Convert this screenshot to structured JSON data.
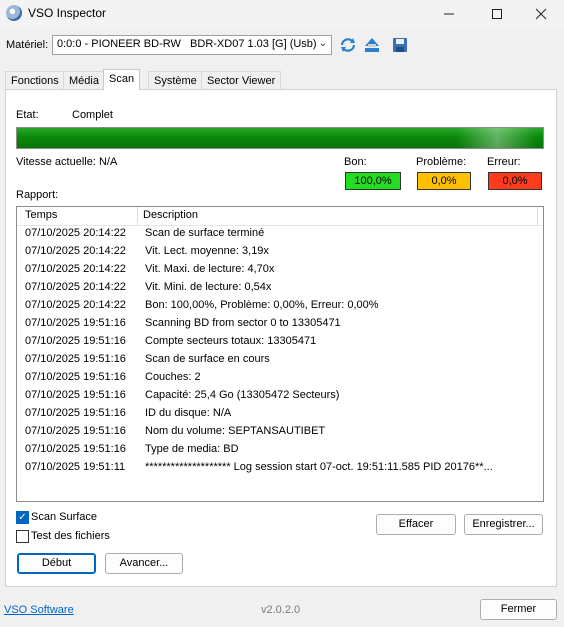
{
  "window": {
    "title": "VSO Inspector",
    "icon": "vso-app-icon"
  },
  "device": {
    "label": "Matériel:",
    "selected": "0:0:0 - PIONEER BD-RW   BDR-XD07 1.03 [G] (Usb)"
  },
  "tabs": [
    {
      "label": "Fonctions"
    },
    {
      "label": "Média"
    },
    {
      "label": "Scan"
    },
    {
      "label": "Système"
    },
    {
      "label": "Sector Viewer"
    }
  ],
  "active_tab": "Scan",
  "status": {
    "state_label": "Etat:",
    "state_value": "Complet",
    "progress_fraction": 1.0,
    "speed_label": "Vitesse actuelle: N/A",
    "report_label": "Rapport:",
    "good": {
      "label": "Bon:",
      "value": "100,0%",
      "color": "#22dd22"
    },
    "problem": {
      "label": "Problème:",
      "value": "0,0%",
      "color": "#ffc000"
    },
    "error": {
      "label": "Erreur:",
      "value": "0,0%",
      "color": "#ff3b1f"
    }
  },
  "report": {
    "columns": [
      "Temps",
      "Description"
    ],
    "rows": [
      {
        "time": "07/10/2025 20:14:22",
        "desc": "Scan de surface terminé"
      },
      {
        "time": "07/10/2025 20:14:22",
        "desc": "Vit. Lect. moyenne: 3,19x"
      },
      {
        "time": "07/10/2025 20:14:22",
        "desc": "Vit. Maxi. de lecture: 4,70x"
      },
      {
        "time": "07/10/2025 20:14:22",
        "desc": "Vit. Mini. de lecture: 0,54x"
      },
      {
        "time": "07/10/2025 20:14:22",
        "desc": "Bon: 100,00%, Problème: 0,00%, Erreur: 0,00%"
      },
      {
        "time": "07/10/2025 19:51:16",
        "desc": "Scanning BD from sector 0 to 13305471"
      },
      {
        "time": "07/10/2025 19:51:16",
        "desc": "Compte secteurs totaux: 13305471"
      },
      {
        "time": "07/10/2025 19:51:16",
        "desc": "Scan de surface en cours"
      },
      {
        "time": "07/10/2025 19:51:16",
        "desc": "Couches: 2"
      },
      {
        "time": "07/10/2025 19:51:16",
        "desc": "Capacité: 25,4 Go (13305472 Secteurs)"
      },
      {
        "time": "07/10/2025 19:51:16",
        "desc": "ID du disque: N/A"
      },
      {
        "time": "07/10/2025 19:51:16",
        "desc": "Nom du volume: SEPTANSAUTIBET"
      },
      {
        "time": "07/10/2025 19:51:16",
        "desc": "Type de media: BD"
      },
      {
        "time": "07/10/2025 19:51:11",
        "desc": "******************** Log session start 07-oct. 19:51:11.585 PID 20176**..."
      }
    ]
  },
  "options": {
    "scan_surface": {
      "label": "Scan Surface",
      "checked": true
    },
    "test_files": {
      "label": "Test des fichiers",
      "checked": false
    }
  },
  "buttons": {
    "clear": "Effacer",
    "save": "Enregistrer...",
    "start": "Début",
    "advanced": "Avancer...",
    "close": "Fermer"
  },
  "footer": {
    "link": "VSO Software",
    "version": "v2.0.2.0"
  }
}
